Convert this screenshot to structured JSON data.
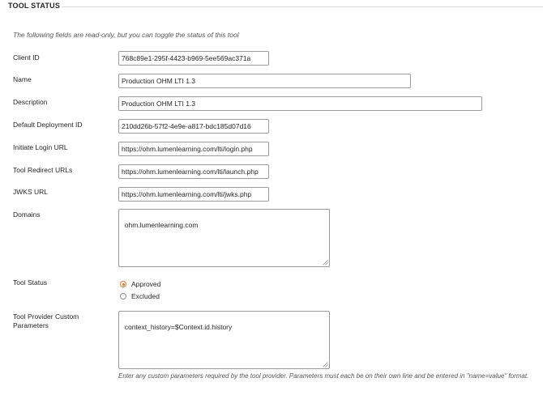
{
  "section": {
    "title": "TOOL STATUS"
  },
  "intro": "The following fields are read-only, but you can toggle the status of this tool",
  "fields": {
    "client_id": {
      "label": "Client ID",
      "value": "768c89e1-295f-4423-b969-5ee569ac371a"
    },
    "name": {
      "label": "Name",
      "value": "Production OHM LTI 1.3"
    },
    "description": {
      "label": "Description",
      "value": "Production OHM LTI 1.3"
    },
    "deployment_id": {
      "label": "Default Deployment ID",
      "value": "210dd26b-57f2-4e9e-a817-bdc185d07d16"
    },
    "login_url": {
      "label": "Initiate Login URL",
      "value": "https://ohm.lumenlearning.com/lti/login.php"
    },
    "redirect_urls": {
      "label": "Tool Redirect URLs",
      "value": "https://ohm.lumenlearning.com/lti/launch.php"
    },
    "jwks_url": {
      "label": "JWKS URL",
      "value": "https://ohm.lumenlearning.com/lti/jwks.php"
    },
    "domains": {
      "label": "Domains",
      "value": "ohm.lumenlearning.com"
    }
  },
  "tool_status": {
    "label": "Tool Status",
    "options": [
      {
        "label": "Approved",
        "checked": true
      },
      {
        "label": "Excluded",
        "checked": false
      }
    ]
  },
  "custom_params": {
    "label_line1": "Tool Provider Custom",
    "label_line2": "Parameters",
    "value": "context_history=$Context.id.history",
    "help": "Enter any custom parameters required by the tool provider. Parameters must each be on their own line and be entered in \"name=value\" format."
  },
  "colors": {
    "accent": "#e0752d",
    "border": "#9a9a9a",
    "rule": "#d9d9d9"
  }
}
